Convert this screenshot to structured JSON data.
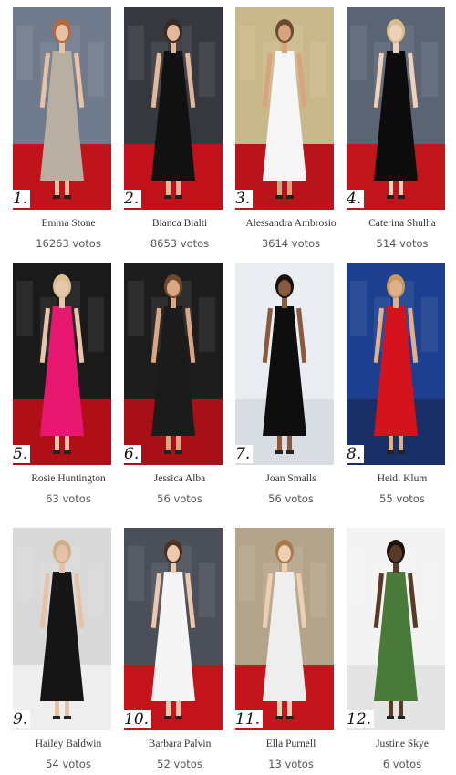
{
  "entries": [
    {
      "rank": "1.",
      "name": "Emma Stone",
      "votes": "16263 votos",
      "bg": "#6f7a8c",
      "carpet": "#c0131a",
      "dress": "#b7b0a2",
      "skin": "#e8c2a4",
      "hair": "#b8683a"
    },
    {
      "rank": "2.",
      "name": "Bianca Bialti",
      "votes": "8653 votos",
      "bg": "#35393f",
      "carpet": "#c1121b",
      "dress": "#111111",
      "skin": "#e3b89a",
      "hair": "#3a2a22"
    },
    {
      "rank": "3.",
      "name": "Alessandra Ambrosio",
      "votes": "3614 votos",
      "bg": "#c9b98a",
      "carpet": "#b9141b",
      "dress": "#f6f6f6",
      "skin": "#d9a37e",
      "hair": "#6b4a32"
    },
    {
      "rank": "4.",
      "name": "Caterina Shulha",
      "votes": "514 votos",
      "bg": "#5a6473",
      "carpet": "#c1151c",
      "dress": "#0c0c0c",
      "skin": "#efd0b8",
      "hair": "#d7bf8c"
    },
    {
      "rank": "5.",
      "name": "Rosie Huntington",
      "votes": "63 votos",
      "bg": "#1a1a1a",
      "carpet": "#b10f18",
      "dress": "#e8176f",
      "skin": "#e9c6ab",
      "hair": "#d9c08d"
    },
    {
      "rank": "6.",
      "name": "Jessica Alba",
      "votes": "56 votos",
      "bg": "#1d1d1d",
      "carpet": "#a80f16",
      "dress": "#1b1b1b",
      "skin": "#d9a784",
      "hair": "#6d4a2b"
    },
    {
      "rank": "7.",
      "name": "Joan Smalls",
      "votes": "56 votos",
      "bg": "#e9edf2",
      "carpet": "#d8dde4",
      "dress": "#0e0e0e",
      "skin": "#8a5a3c",
      "hair": "#1a120c"
    },
    {
      "rank": "8.",
      "name": "Heidi Klum",
      "votes": "55 votos",
      "bg": "#1c3f8f",
      "carpet": "#1a2f66",
      "dress": "#d5131c",
      "skin": "#e0b08c",
      "hair": "#c89a5c"
    },
    {
      "rank": "9.",
      "name": "Hailey Baldwin",
      "votes": "54 votos",
      "bg": "#d8d8d8",
      "carpet": "#eeeeee",
      "dress": "#151515",
      "skin": "#e6c3a7",
      "hair": "#cdb08a"
    },
    {
      "rank": "10.",
      "name": "Barbara Palvin",
      "votes": "52 votos",
      "bg": "#4a4f5a",
      "carpet": "#c3141c",
      "dress": "#f5f5f5",
      "skin": "#ecc8ac",
      "hair": "#4a3122"
    },
    {
      "rank": "11.",
      "name": "Ella Purnell",
      "votes": "13 votos",
      "bg": "#b4a58a",
      "carpet": "#c3151c",
      "dress": "#eeeeee",
      "skin": "#efcfb3",
      "hair": "#a8784a"
    },
    {
      "rank": "12.",
      "name": "Justine Skye",
      "votes": "6 votos",
      "bg": "#f3f3f3",
      "carpet": "#e4e4e4",
      "dress": "#4a7a3a",
      "skin": "#5a3a26",
      "hair": "#1a120c"
    }
  ]
}
